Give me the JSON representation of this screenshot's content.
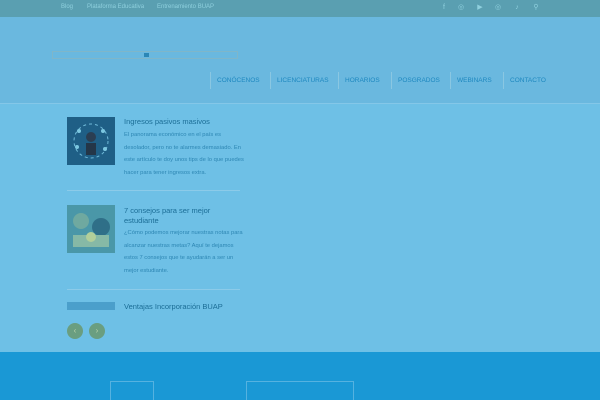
{
  "topbar": {
    "links": [
      "Blog",
      "Plataforma Educativa",
      "Entrenamiento BUAP"
    ],
    "icons": [
      "facebook-icon",
      "instagram-icon",
      "youtube-icon",
      "instagram-alt-icon",
      "tiktok-icon",
      "search-icon"
    ]
  },
  "nav": {
    "items": [
      "CONÓCENOS",
      "LICENCIATURAS",
      "HORARIOS",
      "POSGRADOS",
      "WEBINARS",
      "CONTACTO"
    ]
  },
  "posts": [
    {
      "title": "Ingresos pasivos masivos",
      "excerpt": "El panorama económico en el país es desolador, pero no te alarmes demasiado. En este artículo te doy unos tips de lo que puedes hacer para tener ingresos extra."
    },
    {
      "title": "7 consejos para ser mejor estudiante",
      "excerpt": "¿Cómo podemos mejorar nuestras notas para alcanzar nuestras metas? Aquí te dejamos estos 7 consejos que te ayudarán a ser un mejor estudiante."
    },
    {
      "title": "Ventajas Incorporación BUAP",
      "excerpt": ""
    }
  ],
  "slider": {
    "prev": "‹",
    "next": "›"
  },
  "colors": {
    "accent": "#1e88bf",
    "footer": "#1a98d5",
    "topbar": "#5a9fb1"
  }
}
